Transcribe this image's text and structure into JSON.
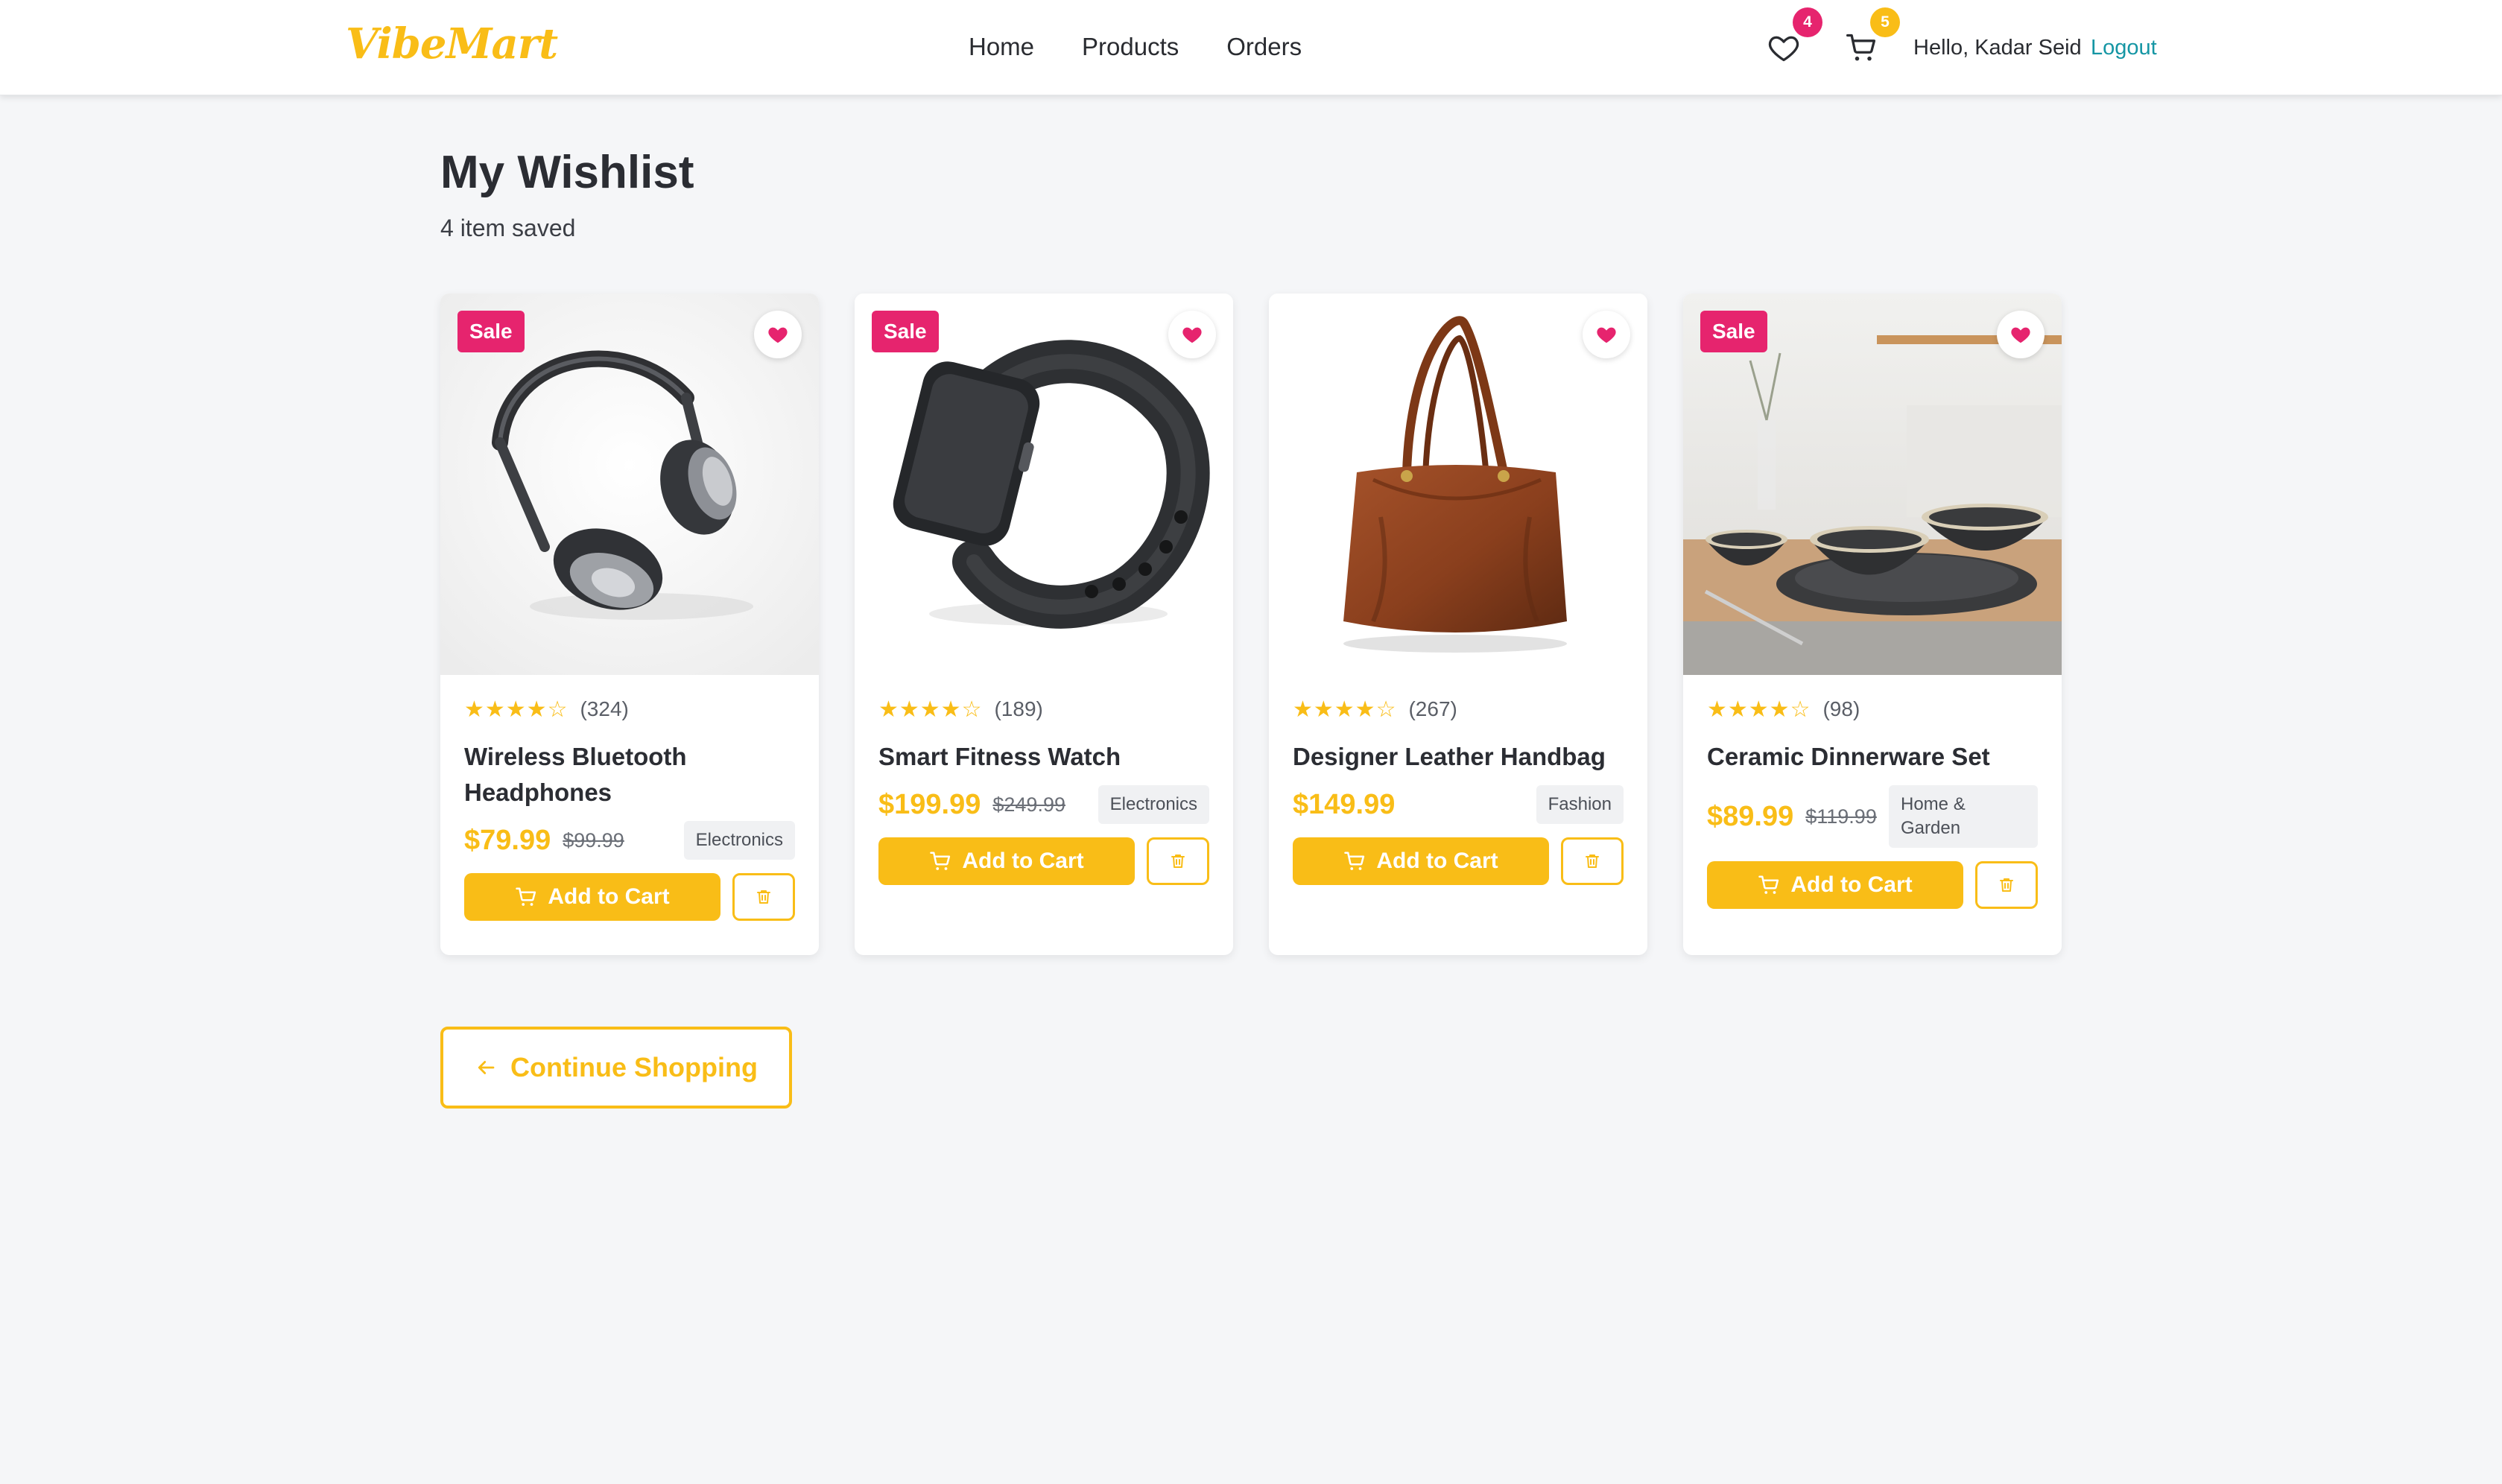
{
  "brand": {
    "logo_text": "VibeMart",
    "accent": "#f9bd17",
    "sale": "#e6246e",
    "link": "#1596a4"
  },
  "nav": {
    "links": [
      "Home",
      "Products",
      "Orders"
    ],
    "wishlist_count": "4",
    "cart_count": "5",
    "greeting": "Hello, Kadar Seid",
    "logout_label": "Logout",
    "icons": {
      "wishlist": "heart-outline-icon",
      "cart": "shopping-cart-icon"
    }
  },
  "page": {
    "title": "My Wishlist",
    "subtitle": "4 item saved"
  },
  "products": [
    {
      "name": "Wireless Bluetooth Headphones",
      "rating": 4,
      "reviews": "(324)",
      "price": "$79.99",
      "old_price": "$99.99",
      "category": "Electronics",
      "sale_label": "Sale",
      "image": "headphones",
      "add_label": "Add to Cart"
    },
    {
      "name": "Smart Fitness Watch",
      "rating": 4,
      "reviews": "(189)",
      "price": "$199.99",
      "old_price": "$249.99",
      "category": "Electronics",
      "sale_label": "Sale",
      "image": "smartwatch",
      "add_label": "Add to Cart"
    },
    {
      "name": "Designer Leather Handbag",
      "rating": 4,
      "reviews": "(267)",
      "price": "$149.99",
      "old_price": "",
      "category": "Fashion",
      "sale_label": "",
      "image": "handbag",
      "add_label": "Add to Cart"
    },
    {
      "name": "Ceramic Dinnerware Set",
      "rating": 4,
      "reviews": "(98)",
      "price": "$89.99",
      "old_price": "$119.99",
      "category": "Home & Garden",
      "sale_label": "Sale",
      "image": "dinnerware",
      "add_label": "Add to Cart"
    }
  ],
  "continue_label": "Continue Shopping"
}
